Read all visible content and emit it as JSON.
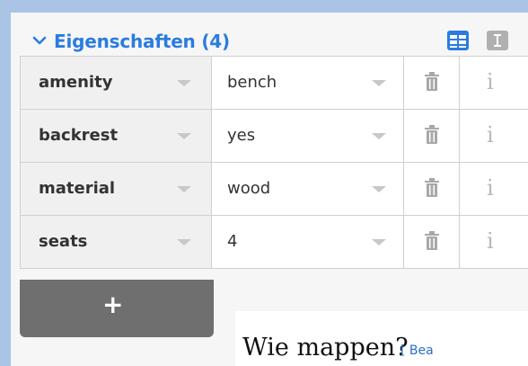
{
  "section": {
    "title": "Eigenschaften (4)",
    "accent_color": "#2a7ce0"
  },
  "view_icons": {
    "table": "table-view-icon",
    "text": "text-view-icon"
  },
  "tags": [
    {
      "key": "amenity",
      "value": "bench"
    },
    {
      "key": "backrest",
      "value": "yes"
    },
    {
      "key": "material",
      "value": "wood"
    },
    {
      "key": "seats",
      "value": "4"
    }
  ],
  "row_actions": {
    "delete_icon": "trash-icon",
    "info_icon": "info-icon",
    "info_glyph": "i"
  },
  "add_button": {
    "label": "+"
  },
  "wiki": {
    "title": "Wie mappen?",
    "link": "[ Bea"
  }
}
